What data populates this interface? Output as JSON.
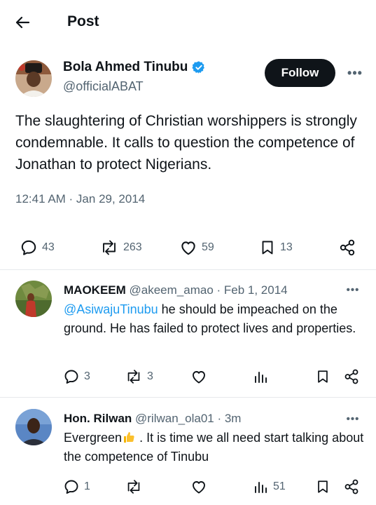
{
  "header": {
    "title": "Post"
  },
  "post": {
    "author_name": "Bola Ahmed Tinubu",
    "author_handle": "@officialABAT",
    "follow_label": "Follow",
    "more_label": "•••",
    "text": "The slaughtering of Christian worshippers  is strongly condemnable. It calls to question the competence of Jonathan to protect Nigerians.",
    "timestamp": "12:41 AM · Jan 29, 2014",
    "stats": {
      "replies": "43",
      "reposts": "263",
      "likes": "59",
      "bookmarks": "13"
    }
  },
  "replies": [
    {
      "name": "MAOKEEM",
      "handle": "@akeem_amao",
      "date": " · Feb 1, 2014",
      "mention": "@AsiwajuTinubu",
      "text": " he should be impeached on the ground. He has failed to protect lives and properties.",
      "more_label": "•••",
      "stats": {
        "replies": "3",
        "reposts": "3",
        "likes": "",
        "views": ""
      }
    },
    {
      "name": "Hon. Rilwan",
      "handle": "@rilwan_ola01",
      "date": " · 3m",
      "text_before": "Evergreen",
      "text_after": " . It is time we all need start talking about the competence of Tinubu",
      "more_label": "•••",
      "stats": {
        "replies": "1",
        "reposts": "",
        "likes": "",
        "views": "51"
      }
    }
  ],
  "colors": {
    "text": "#0f1419",
    "muted": "#536471",
    "link": "#1d9bf0",
    "verified": "#1d9bf0"
  },
  "icons": [
    "back-arrow-icon",
    "verified-badge-icon",
    "reply-icon",
    "repost-icon",
    "like-icon",
    "bookmark-icon",
    "share-icon",
    "views-icon",
    "thumbs-up-emoji"
  ]
}
